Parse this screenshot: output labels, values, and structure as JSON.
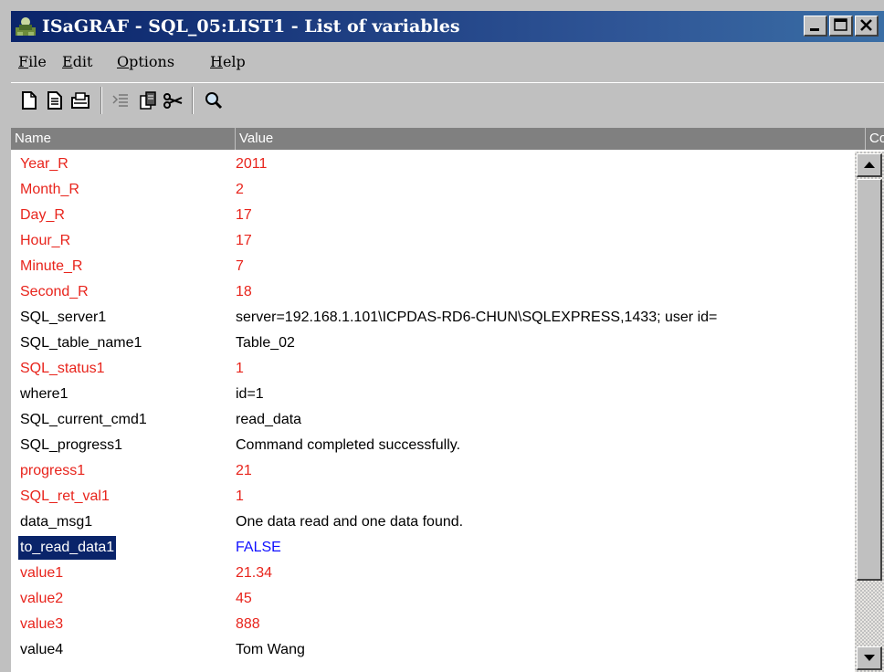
{
  "window": {
    "title": "ISaGRAF - SQL_05:LIST1 - List of variables"
  },
  "menu": [
    {
      "label": "File",
      "mnemonic": "F",
      "rest": "ile"
    },
    {
      "label": "Edit",
      "mnemonic": "E",
      "rest": "dit"
    },
    {
      "label": "Options",
      "mnemonic": "O",
      "rest": "ptions"
    },
    {
      "label": "Help",
      "mnemonic": "H",
      "rest": "elp"
    }
  ],
  "toolbar": {
    "icons": [
      "new-document-icon",
      "edit-document-icon",
      "open-folder-icon",
      "insert-variable-icon",
      "paste-icon",
      "cut-scissors-icon",
      "search-magnifier-icon"
    ]
  },
  "list": {
    "headers": {
      "name": "Name",
      "value": "Value",
      "comment": "Co"
    },
    "rows": [
      {
        "name": "Year_R",
        "value": "2011",
        "color": "red"
      },
      {
        "name": "Month_R",
        "value": "2",
        "color": "red"
      },
      {
        "name": "Day_R",
        "value": "17",
        "color": "red"
      },
      {
        "name": "Hour_R",
        "value": "17",
        "color": "red"
      },
      {
        "name": "Minute_R",
        "value": "7",
        "color": "red"
      },
      {
        "name": "Second_R",
        "value": "18",
        "color": "red"
      },
      {
        "name": "SQL_server1",
        "value": "server=192.168.1.101\\ICPDAS-RD6-CHUN\\SQLEXPRESS,1433; user id=",
        "color": "black"
      },
      {
        "name": "SQL_table_name1",
        "value": "Table_02",
        "color": "black"
      },
      {
        "name": "SQL_status1",
        "value": "1",
        "color": "red"
      },
      {
        "name": "where1",
        "value": "id=1",
        "color": "black"
      },
      {
        "name": "SQL_current_cmd1",
        "value": "read_data",
        "color": "black"
      },
      {
        "name": "SQL_progress1",
        "value": "Command completed successfully.",
        "color": "black"
      },
      {
        "name": "progress1",
        "value": "21",
        "color": "red"
      },
      {
        "name": "SQL_ret_val1",
        "value": "1",
        "color": "red"
      },
      {
        "name": "data_msg1",
        "value": "One data read and one data found.",
        "color": "black"
      },
      {
        "name": "to_read_data1",
        "value": "FALSE",
        "color": "blue",
        "selected": true
      },
      {
        "name": "value1",
        "value": "21.34",
        "color": "red"
      },
      {
        "name": "value2",
        "value": "45",
        "color": "red"
      },
      {
        "name": "value3",
        "value": "888",
        "color": "red"
      },
      {
        "name": "value4",
        "value": "Tom Wang",
        "color": "black"
      }
    ]
  },
  "colors": {
    "title_bar": "#0a246a",
    "header_bg": "#808080",
    "red_text": "#e8241c",
    "blue_text": "#1010ff",
    "selection": "#0a246a"
  }
}
